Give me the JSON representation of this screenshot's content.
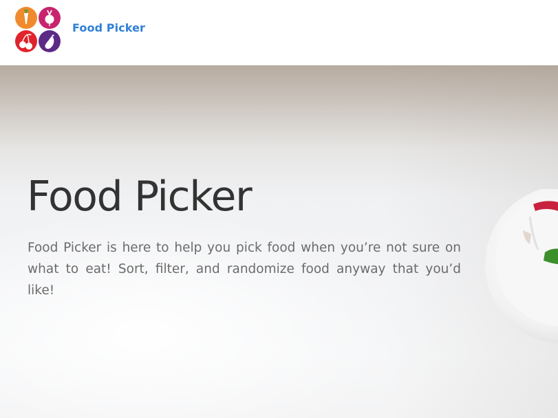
{
  "header": {
    "brand": "Food Picker",
    "logo_icons": [
      "carrot-icon",
      "beet-icon",
      "cherries-icon",
      "eggplant-icon"
    ],
    "brand_color": "#2f80d6"
  },
  "hero": {
    "title": "Food Picker",
    "description": "Food Picker is here to help you pick food when you’re not sure on what to eat! Sort, filter, and randomize food anyway that you’d like!",
    "title_color": "#333333",
    "text_color": "#6b6b6b"
  }
}
